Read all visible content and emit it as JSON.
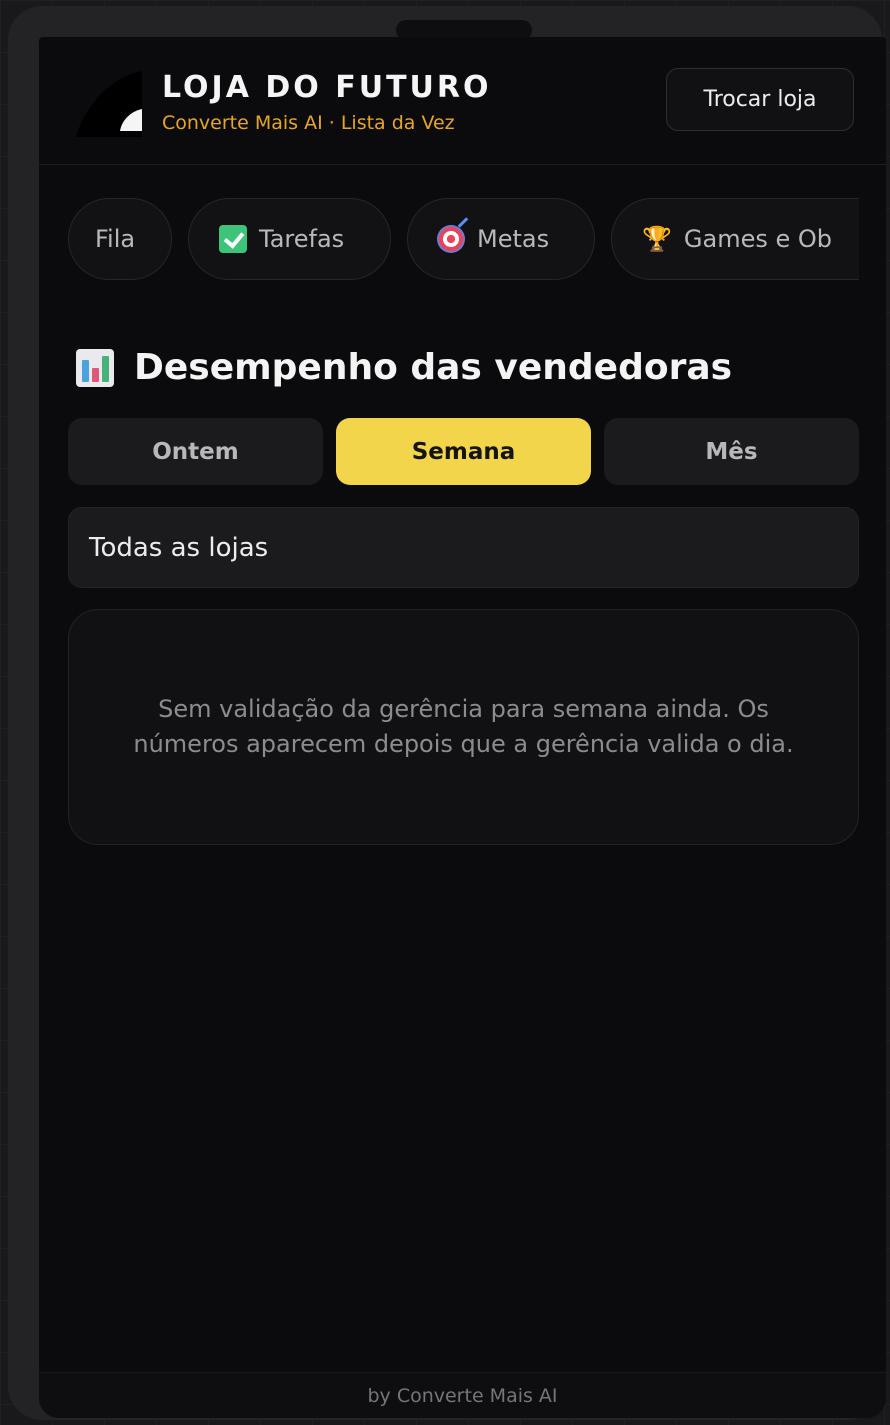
{
  "header": {
    "title": "LOJA DO FUTURO",
    "subtitle": "Converte Mais AI · Lista da Vez",
    "switch_store_label": "Trocar loja"
  },
  "tabs": [
    {
      "label": "Fila",
      "icon": "none"
    },
    {
      "label": "Tarefas",
      "icon": "check-box-icon"
    },
    {
      "label": "Metas",
      "icon": "target-icon"
    },
    {
      "label": "Games e Ob",
      "icon": "trophy-icon"
    }
  ],
  "section": {
    "title": "Desempenho das vendedoras",
    "icon": "bar-chart-icon"
  },
  "periods": [
    {
      "label": "Ontem",
      "active": false
    },
    {
      "label": "Semana",
      "active": true
    },
    {
      "label": "Mês",
      "active": false
    }
  ],
  "store_filter": {
    "value": "Todas as lojas"
  },
  "empty_state": {
    "message": "Sem validação da gerência para semana ainda. Os números aparecem depois que a gerência valida o dia."
  },
  "footer": {
    "text": "by Converte Mais AI"
  },
  "colors": {
    "accent_yellow": "#f2d54b",
    "brand_orange": "#e6a52a",
    "background": "#0b0b0d"
  }
}
